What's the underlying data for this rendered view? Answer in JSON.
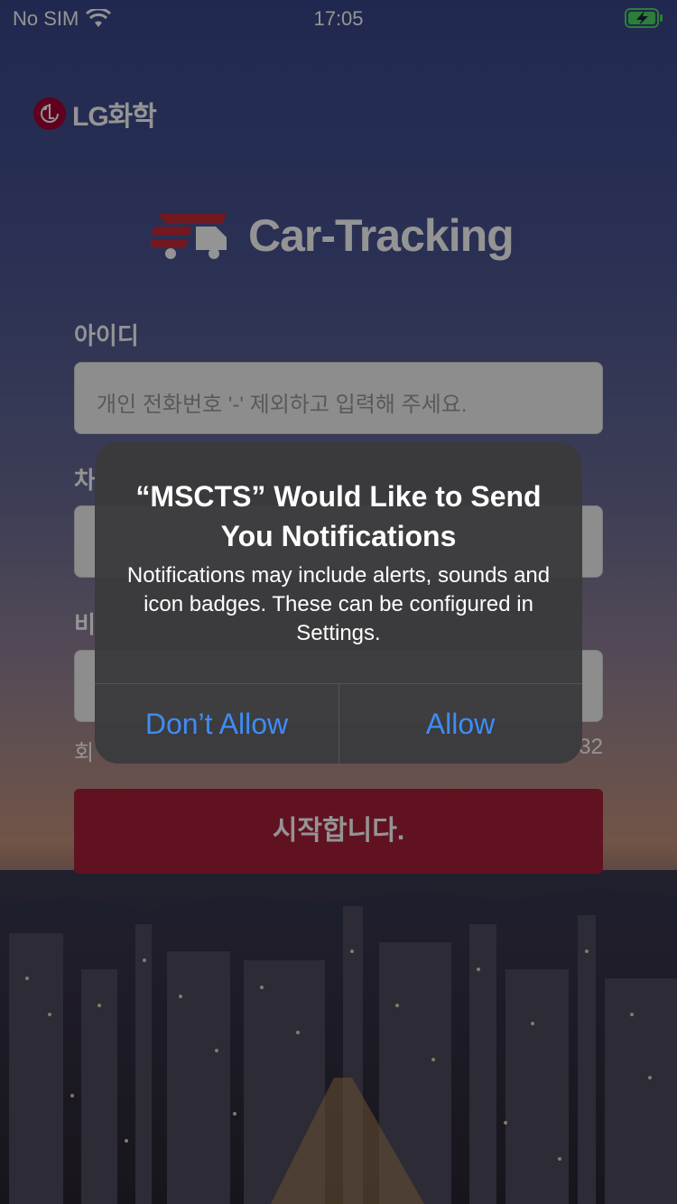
{
  "status_bar": {
    "carrier": "No SIM",
    "time": "17:05",
    "wifi_icon": "wifi-icon",
    "battery_icon": "battery-charging-icon"
  },
  "branding": {
    "company_logo_text": "LG화학",
    "app_title": "Car-Tracking",
    "app_icon": "truck-icon"
  },
  "form": {
    "id_label": "아이디",
    "id_placeholder": "개인 전화번호 '-' 제외하고 입력해 주세요.",
    "field2_label_partial": "차",
    "field3_label_partial": "비",
    "hint_left_partial": "회",
    "hint_right_partial": "32",
    "start_button": "시작합니다."
  },
  "alert": {
    "title": "“MSCTS” Would Like to Send You Notifications",
    "message": "Notifications may include alerts, sounds and icon badges. These can be configured in Settings.",
    "dont_allow_label": "Don’t Allow",
    "allow_label": "Allow"
  },
  "colors": {
    "accent_button": "#a8203a",
    "alert_button_text": "#3e8cf5",
    "lg_red": "#a50034"
  }
}
